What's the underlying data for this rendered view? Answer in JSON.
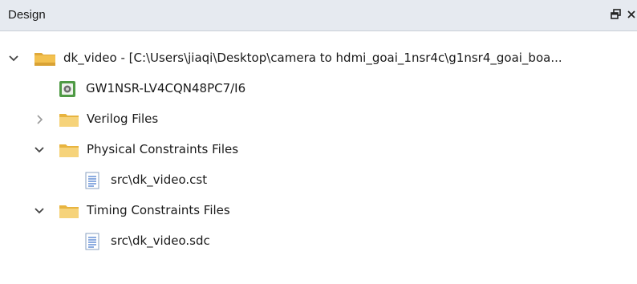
{
  "panel": {
    "title": "Design",
    "restore_icon": "float-restore-icon",
    "close_icon": "close-icon"
  },
  "tree": {
    "project": {
      "label": "dk_video - [C:\\Users\\jiaqi\\Desktop\\camera to hdmi_goai_1nsr4c\\g1nsr4_goai_boa...",
      "expanded": true,
      "icon": "project-folder-icon"
    },
    "device": {
      "label": "GW1NSR-LV4CQN48PC7/I6",
      "icon": "chip-icon"
    },
    "verilog": {
      "label": "Verilog Files",
      "expanded": false,
      "icon": "folder-icon"
    },
    "physical": {
      "label": "Physical Constraints Files",
      "expanded": true,
      "icon": "folder-icon",
      "file": {
        "label": "src\\dk_video.cst",
        "icon": "file-icon"
      }
    },
    "timing": {
      "label": "Timing Constraints Files",
      "expanded": true,
      "icon": "folder-icon",
      "file": {
        "label": "src\\dk_video.sdc",
        "icon": "file-icon"
      }
    }
  },
  "colors": {
    "header_bg": "#e6eaf0",
    "folder": "#f3c14f",
    "chip_border": "#3f8a3a"
  }
}
